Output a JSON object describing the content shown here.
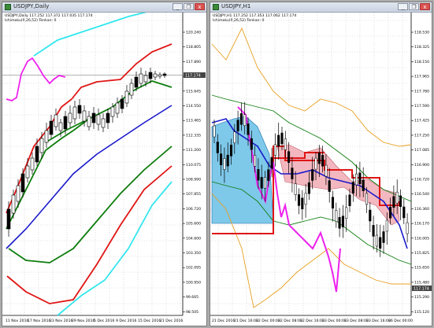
{
  "left_window": {
    "title": "USDJPY,Daily",
    "symbol_line": "USDJPY,Daily 117.252 117.372 117.035 117.174",
    "indicator_line": "Ichimoku(9,26,52) Tenkan: 0",
    "price_axis": [
      "120.240",
      "118.805",
      "117.890",
      "116.750",
      "115.645",
      "114.550",
      "113.465",
      "112.335",
      "111.200",
      "110.075",
      "108.990",
      "107.855",
      "106.720",
      "105.600",
      "104.600",
      "103.350",
      "102.095",
      "100.950",
      "99.665",
      "98.505"
    ],
    "current_price": "117.174",
    "time_axis": [
      "11 Nov 2016",
      "17 Nov 2016",
      "23 Nov 2016",
      "29 Nov 2016",
      "5 Dec 2016",
      "9 Dec 2016",
      "15 Dec 2016",
      "21 Dec 2016"
    ],
    "colors": {
      "bands_outer": "#33e6ee",
      "bands_mid": "#e01515",
      "bands_inner": "#0d7d0d",
      "center": "#1a1acc",
      "chikou": "#ee22ee",
      "candle": "#000000"
    }
  },
  "right_window": {
    "title": "USDJPY,H1",
    "symbol_line": "USDJPY,H1 117.252 117.353 117.062 117.174",
    "indicator_line": "Ichimoku(9,26,52) Tenkan: 0",
    "price_axis": [
      "118.530",
      "118.325",
      "118.150",
      "117.965",
      "117.780",
      "117.590",
      "117.425",
      "117.250",
      "117.085",
      "116.900",
      "116.720",
      "116.540",
      "116.360",
      "116.170",
      "116.005",
      "115.825",
      "115.650",
      "115.480",
      "115.290",
      "115.120"
    ],
    "current_price": "117.174",
    "time_axis": [
      "21 Dec 2016",
      "21 Dec 16:00",
      "22 Dec 00:00",
      "22 Dec 08:00",
      "22 Dec 16:00",
      "23 Dec 00:00",
      "23 Dec 08:00",
      "23 Dec 16:00",
      "26 Dec 00:00"
    ],
    "colors": {
      "cloud_a": "#7ec8ea",
      "cloud_b": "#f3b8bf",
      "kijun": "#e01515",
      "tenkan": "#1a1acc",
      "chikou": "#ee22ee",
      "bands": "#e8a020",
      "mid_band": "#0d7d0d",
      "candle": "#000000"
    }
  },
  "window_buttons": {
    "minimize": "_",
    "restore": "❐",
    "close": "x"
  }
}
